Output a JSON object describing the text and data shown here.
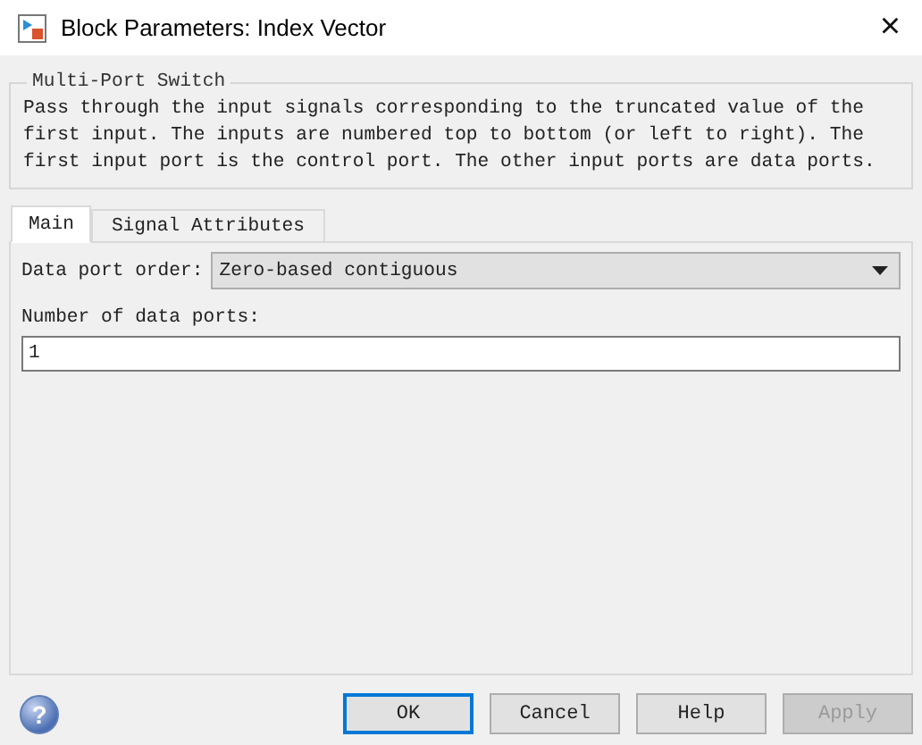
{
  "window": {
    "title": "Block Parameters: Index Vector",
    "close": "×"
  },
  "group": {
    "title": "Multi-Port Switch",
    "description": "Pass through the input signals corresponding to the truncated value of the first input. The inputs are numbered top to bottom (or left to right). The first input port is the control port. The other input ports are data ports."
  },
  "tabs": [
    {
      "label": "Main",
      "selected": true
    },
    {
      "label": "Signal Attributes",
      "selected": false
    }
  ],
  "fields": [
    {
      "kind": "dropdown",
      "label": "Data port order:",
      "value": "Zero-based contiguous"
    },
    {
      "kind": "text",
      "label": "Number of data ports:",
      "value": "1"
    }
  ],
  "help": "?",
  "buttons": [
    {
      "label": "OK",
      "default": true,
      "disabled": false
    },
    {
      "label": "Cancel",
      "default": false,
      "disabled": false
    },
    {
      "label": "Help",
      "default": false,
      "disabled": false
    },
    {
      "label": "Apply",
      "default": false,
      "disabled": true
    }
  ]
}
